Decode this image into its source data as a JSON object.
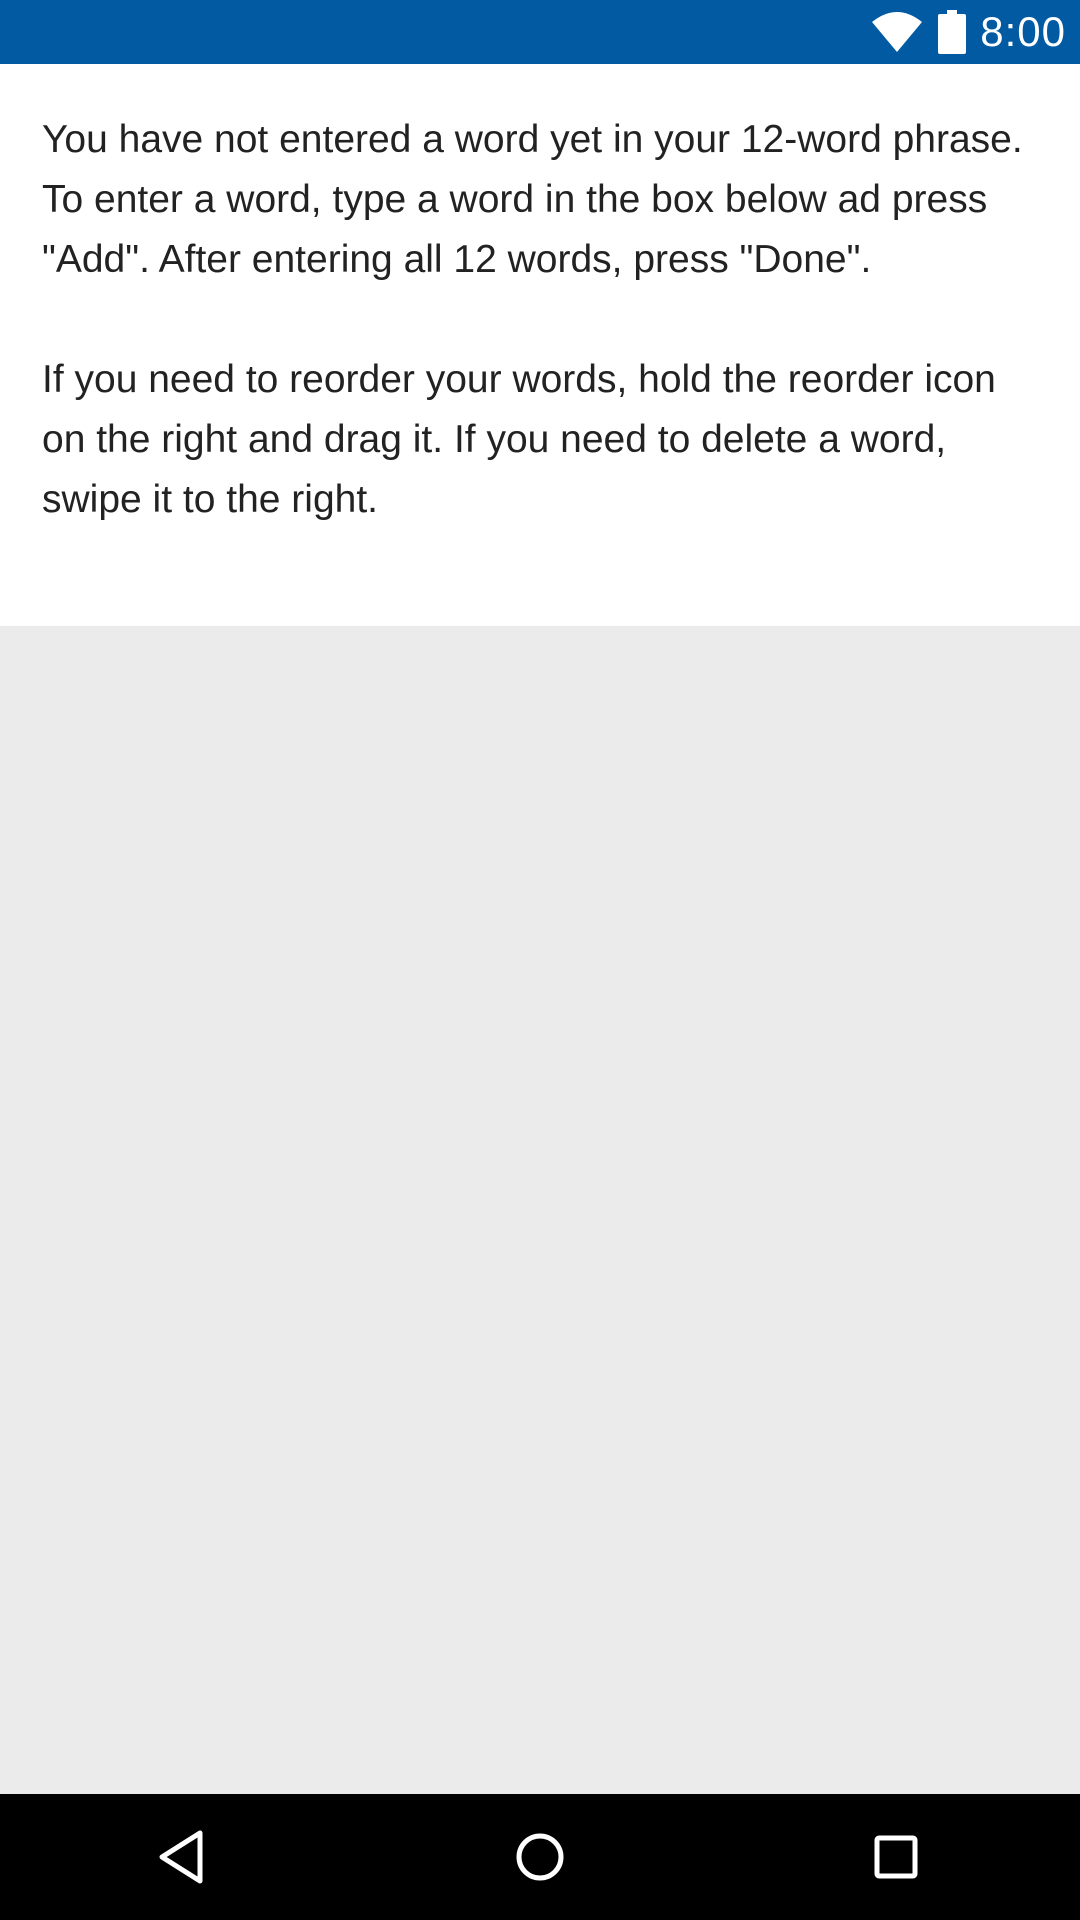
{
  "status_bar": {
    "time": "8:00",
    "background_color": "#015aa2",
    "icons": [
      "wifi-icon",
      "battery-icon"
    ]
  },
  "instructions": {
    "paragraph_1": "You have not entered a word yet in your 12-word phrase. To enter a word, type a word in the box below ad press \"Add\". After entering all 12 words, press \"Done\".",
    "paragraph_2": "If you need to reorder your words, hold the reorder icon on the right and drag it. If you need to delete a word, swipe it to the right."
  },
  "navigation_bar": {
    "buttons": [
      "back-icon",
      "home-icon",
      "recents-icon"
    ]
  }
}
